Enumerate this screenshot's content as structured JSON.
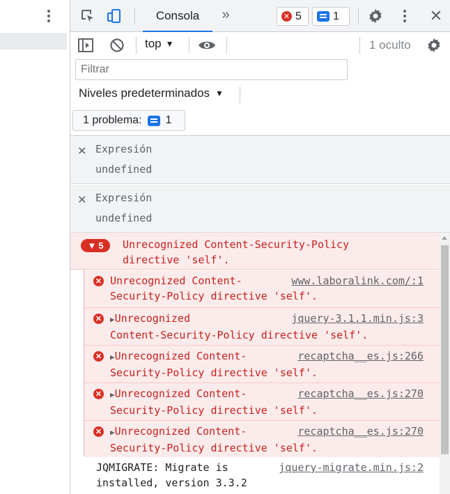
{
  "tabbar": {
    "console_tab": "Consola",
    "more_tabs_glyph": "»",
    "error_badge_count": "5",
    "info_badge_count": "1",
    "close_glyph": "✕"
  },
  "toolbar": {
    "context": "top",
    "hidden_count": "1 oculto"
  },
  "filter": {
    "placeholder": "Filtrar",
    "value": "Filtrar"
  },
  "levels": {
    "label": "Niveles predeterminados"
  },
  "issues": {
    "label": "1 problema:",
    "count": "1"
  },
  "live_expressions": [
    {
      "label": "Expresión",
      "value": "undefined"
    },
    {
      "label": "Expresión",
      "value": "undefined"
    }
  ],
  "console": {
    "group": {
      "count": "5",
      "message": "Unrecognized Content-Security-Policy\ndirective 'self'."
    },
    "errors": [
      {
        "line1": "Unrecognized Content-",
        "line2": "Security-Policy directive 'self'.",
        "source": "www.laboralink.com/:1",
        "expandable": false
      },
      {
        "line1": "Unrecognized",
        "line2": "Content-Security-Policy directive 'self'.",
        "source": "jquery-3.1.1.min.js:3",
        "expandable": true
      },
      {
        "line1": "Unrecognized Content-",
        "line2": "Security-Policy directive 'self'.",
        "source": "recaptcha__es.js:266",
        "expandable": true
      },
      {
        "line1": "Unrecognized Content-",
        "line2": "Security-Policy directive 'self'.",
        "source": "recaptcha__es.js:270",
        "expandable": true
      },
      {
        "line1": "Unrecognized Content-",
        "line2": "Security-Policy directive 'self'.",
        "source": "recaptcha__es.js:270",
        "expandable": true
      }
    ],
    "log": {
      "line1": "JQMIGRATE: Migrate is",
      "line2": "installed, version 3.3.2",
      "source": "jquery-migrate.min.js:2"
    }
  },
  "colors": {
    "accent": "#1a73e8",
    "error": "#d93025",
    "error_text": "#c5221f",
    "error_bg": "#fcebeb"
  }
}
